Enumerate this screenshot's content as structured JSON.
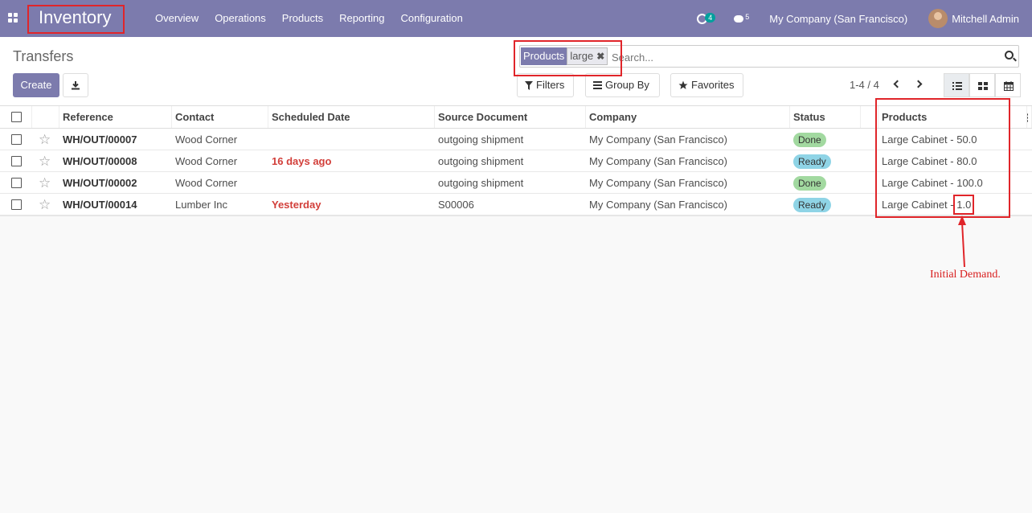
{
  "nav": {
    "app_name": "Inventory",
    "menu": [
      "Overview",
      "Operations",
      "Products",
      "Reporting",
      "Configuration"
    ],
    "activity_count": "4",
    "message_count": "5",
    "company": "My Company (San Francisco)",
    "user": "Mitchell Admin",
    "brand_color": "#7c7bad"
  },
  "control": {
    "title": "Transfers",
    "create_label": "Create",
    "facet_label": "Products",
    "facet_value": "large",
    "search_placeholder": "Search...",
    "filters_label": "Filters",
    "groupby_label": "Group By",
    "favorites_label": "Favorites",
    "pager": "1-4 / 4"
  },
  "table": {
    "headers": {
      "reference": "Reference",
      "contact": "Contact",
      "scheduled_date": "Scheduled Date",
      "source_document": "Source Document",
      "company": "Company",
      "status": "Status",
      "products": "Products"
    },
    "rows": [
      {
        "reference": "WH/OUT/00007",
        "contact": "Wood Corner",
        "scheduled_date": "",
        "source_document": "outgoing shipment",
        "company": "My Company (San Francisco)",
        "status": "Done",
        "products": "Large Cabinet - 50.0"
      },
      {
        "reference": "WH/OUT/00008",
        "contact": "Wood Corner",
        "scheduled_date": "16 days ago",
        "source_document": "outgoing shipment",
        "company": "My Company (San Francisco)",
        "status": "Ready",
        "products": "Large Cabinet - 80.0"
      },
      {
        "reference": "WH/OUT/00002",
        "contact": "Wood Corner",
        "scheduled_date": "",
        "source_document": "outgoing shipment",
        "company": "My Company (San Francisco)",
        "status": "Done",
        "products": "Large Cabinet - 100.0"
      },
      {
        "reference": "WH/OUT/00014",
        "contact": "Lumber Inc",
        "scheduled_date": "Yesterday",
        "source_document": "S00006",
        "company": "My Company (San Francisco)",
        "status": "Ready",
        "products_prefix": "Large Cabinet - ",
        "products_qty": "1.0"
      }
    ]
  },
  "annotation": {
    "note": "Initial Demand.",
    "color": "#e0252a"
  }
}
